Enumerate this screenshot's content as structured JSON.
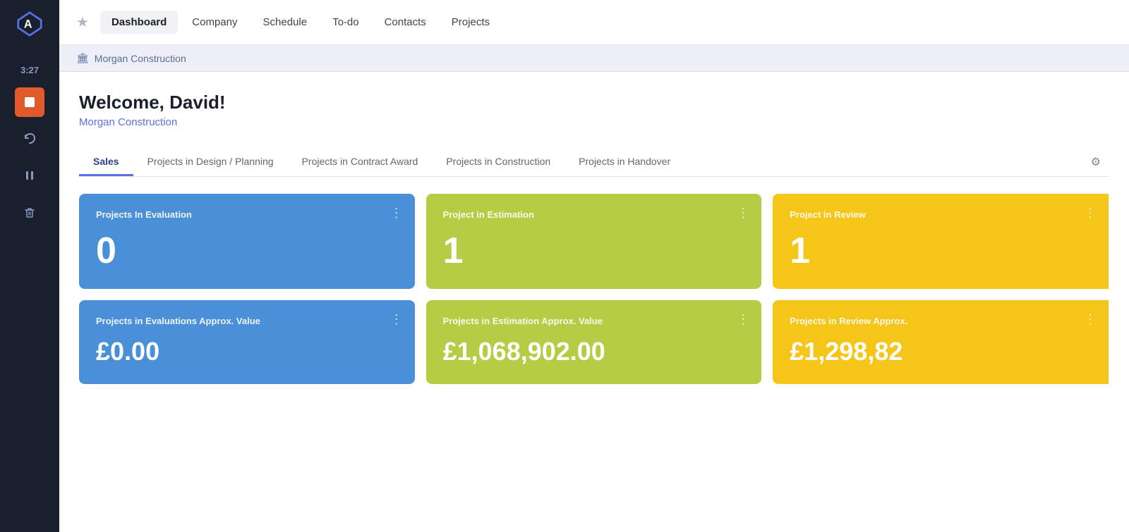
{
  "sidebar": {
    "logo_alt": "Airtable logo",
    "time": "3:27",
    "buttons": [
      {
        "name": "orange-button",
        "icon": "square",
        "color": "orange"
      },
      {
        "name": "undo-button",
        "icon": "undo",
        "color": "transparent"
      },
      {
        "name": "pause-button",
        "icon": "pause",
        "color": "transparent"
      },
      {
        "name": "trash-button",
        "icon": "trash",
        "color": "transparent"
      }
    ]
  },
  "topnav": {
    "star_label": "★",
    "nav_items": [
      {
        "label": "Dashboard",
        "active": true
      },
      {
        "label": "Company",
        "active": false
      },
      {
        "label": "Schedule",
        "active": false
      },
      {
        "label": "To-do",
        "active": false
      },
      {
        "label": "Contacts",
        "active": false
      },
      {
        "label": "Projects",
        "active": false
      }
    ]
  },
  "breadcrumb": {
    "icon": "🏛",
    "text": "Morgan Construction"
  },
  "header": {
    "welcome": "Welcome, David!",
    "company": "Morgan Construction"
  },
  "tabs": [
    {
      "label": "Sales",
      "active": true
    },
    {
      "label": "Projects in Design / Planning",
      "active": false
    },
    {
      "label": "Projects in Contract Award",
      "active": false
    },
    {
      "label": "Projects in Construction",
      "active": false
    },
    {
      "label": "Projects in Handover",
      "active": false
    }
  ],
  "cards": {
    "row1": [
      {
        "id": "eval",
        "color": "blue",
        "title": "Projects In Evaluation",
        "value": "0"
      },
      {
        "id": "estimation",
        "color": "green",
        "title": "Project in Estimation",
        "value": "1"
      },
      {
        "id": "review",
        "color": "yellow",
        "title": "Project in Review",
        "value": "1",
        "partial": true
      }
    ],
    "row2": [
      {
        "id": "eval-value",
        "color": "blue",
        "title": "Projects in Evaluations Approx. Value",
        "value": "£0.00",
        "currency": true
      },
      {
        "id": "estimation-value",
        "color": "green",
        "title": "Projects in Estimation Approx. Value",
        "value": "£1,068,902.00",
        "currency": true
      },
      {
        "id": "review-value",
        "color": "yellow",
        "title": "Projects in Review Approx.",
        "value": "£1,298,82",
        "currency": true,
        "partial": true
      }
    ]
  }
}
